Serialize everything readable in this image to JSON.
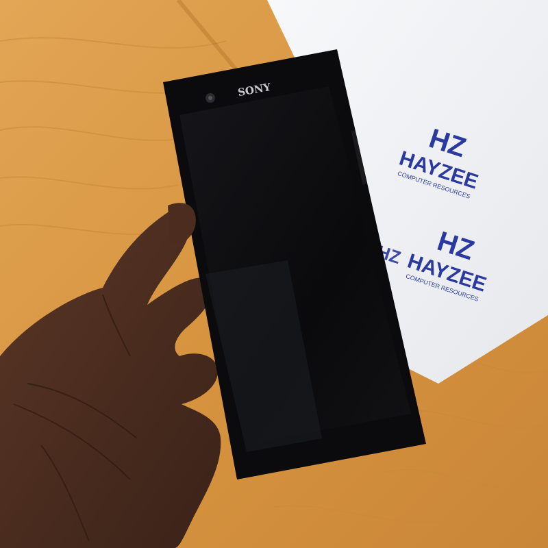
{
  "photo": {
    "subject": "Sony smartphone held in hand",
    "phone": {
      "brand_label": "SONY",
      "body_color": "#0b0b0d"
    },
    "backdrop": {
      "logo_monogram": "HZ",
      "logo_name": "HAYZEE",
      "logo_tagline": "COMPUTER RESOURCES",
      "logo_color": "#2b3a9e"
    },
    "colors": {
      "wood": "#d89a4a",
      "wood_dark": "#c27f32",
      "paper": "#f2f3f5",
      "skin": "#4a2c1f"
    }
  }
}
